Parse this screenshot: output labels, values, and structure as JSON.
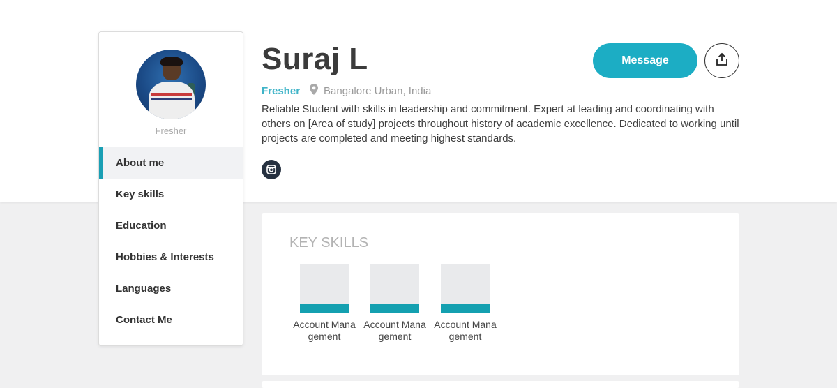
{
  "profile": {
    "name": "Suraj L",
    "status": "Fresher",
    "location": "Bangalore Urban, India",
    "bio": "Reliable Student with skills in leadership and commitment. Expert at leading and coordinating with others on [Area of study] projects throughout history of academic excellence. Dedicated to working until projects are completed and meeting highest standards."
  },
  "sidebar": {
    "role": "Fresher",
    "items": [
      {
        "label": "About me"
      },
      {
        "label": "Key skills"
      },
      {
        "label": "Education"
      },
      {
        "label": "Hobbies & Interests"
      },
      {
        "label": "Languages"
      },
      {
        "label": "Contact Me"
      }
    ],
    "active_index": 0
  },
  "actions": {
    "message_label": "Message",
    "share_icon": "share-upload-icon"
  },
  "social": {
    "icon": "instagram-icon"
  },
  "skills": {
    "title": "KEY SKILLS",
    "items": [
      {
        "label": "Account Management"
      },
      {
        "label": "Account Management"
      },
      {
        "label": "Account Management"
      }
    ]
  },
  "colors": {
    "accent": "#1cadc4",
    "skill_bar": "#14a0b0",
    "status": "#3fb4c8",
    "page_bg": "#f0f0f1"
  }
}
